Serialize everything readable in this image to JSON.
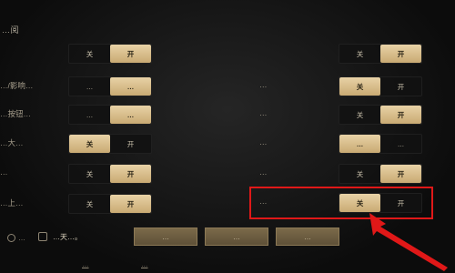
{
  "section_title": "…阅",
  "left_rows": [
    {
      "label": "",
      "options": [
        "关",
        "开"
      ],
      "selected": 1
    },
    {
      "label": "…/影响…",
      "options": [
        "…",
        "…"
      ],
      "selected": 1
    },
    {
      "label": "…按钮…",
      "options": [
        "…",
        "…"
      ],
      "selected": 1
    },
    {
      "label": "…大…",
      "options": [
        "关",
        "开"
      ],
      "selected": 0
    },
    {
      "label": "…",
      "options": [
        "关",
        "开"
      ],
      "selected": 1
    },
    {
      "label": "…上…",
      "options": [
        "关",
        "开"
      ],
      "selected": 1
    }
  ],
  "right_rows": [
    {
      "label": "",
      "options": [
        "关",
        "开"
      ],
      "selected": 1
    },
    {
      "label": "…",
      "options": [
        "关",
        "开"
      ],
      "selected": 0
    },
    {
      "label": "…",
      "options": [
        "关",
        "开"
      ],
      "selected": 1
    },
    {
      "label": "…",
      "options": [
        "…",
        "…"
      ],
      "selected": 0
    },
    {
      "label": "…",
      "options": [
        "关",
        "开"
      ],
      "selected": 1
    },
    {
      "label": "…",
      "options": [
        "关",
        "开"
      ],
      "selected": 0
    }
  ],
  "bottom": {
    "small_label": "…",
    "checkbox_text": "…天…。",
    "buttons": [
      "…",
      "…",
      "…"
    ],
    "links": [
      "…",
      "…"
    ]
  },
  "colors": {
    "accent": "#d8bb86",
    "highlight": "#e01818",
    "text": "#cfc6b0",
    "background": "#0b0b0b"
  }
}
